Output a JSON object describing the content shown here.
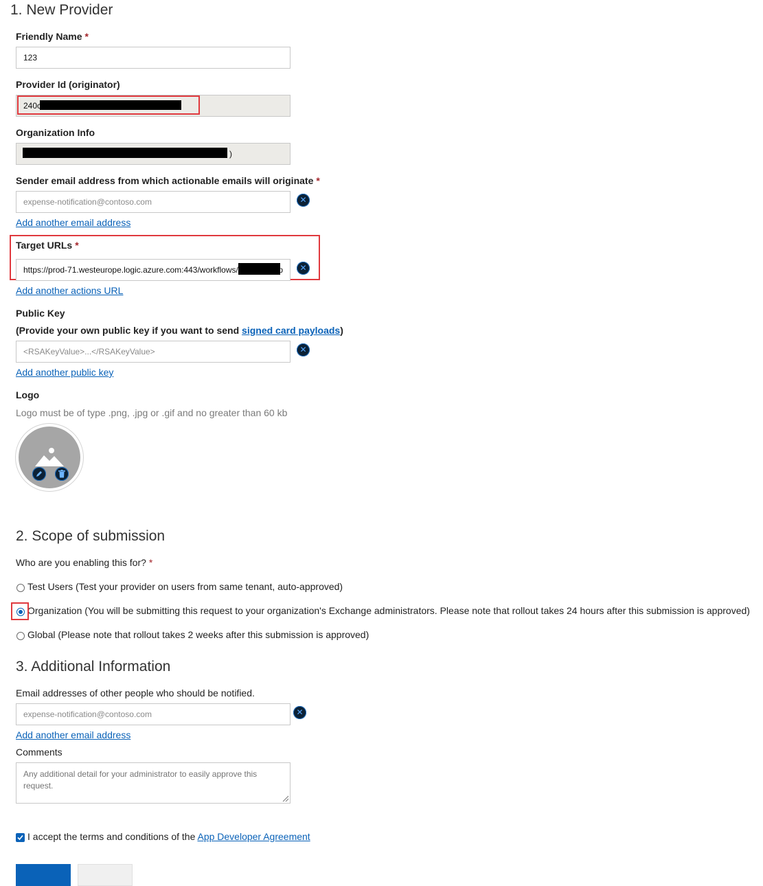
{
  "section1": {
    "title": "1. New Provider",
    "friendly_name": {
      "label": "Friendly Name",
      "required": "*",
      "value": "123"
    },
    "provider_id": {
      "label": "Provider Id (originator)",
      "value": "240c"
    },
    "org_info": {
      "label": "Organization Info",
      "value_suffix": ")"
    },
    "sender_email": {
      "label": "Sender email address from which actionable emails will originate",
      "required": "*",
      "placeholder": "expense-notification@contoso.com",
      "add_link": "Add another email address"
    },
    "target_urls": {
      "label": "Target URLs",
      "required": "*",
      "value": "https://prod-71.westeurope.logic.azure.com:443/workflows/",
      "value_tail": "p",
      "add_link": "Add another actions URL"
    },
    "public_key": {
      "label": "Public Key",
      "hint_prefix": "(Provide your own public key if you want to send ",
      "hint_link": "signed card payloads",
      "hint_suffix": ")",
      "placeholder": "<RSAKeyValue>...</RSAKeyValue>",
      "add_link": "Add another public key"
    },
    "logo": {
      "label": "Logo",
      "hint": "Logo must be of type .png, .jpg or .gif and no greater than 60 kb"
    }
  },
  "section2": {
    "title": "2. Scope of submission",
    "question": "Who are you enabling this for?",
    "required": "*",
    "options": [
      {
        "label": "Test Users (Test your provider on users from same tenant, auto-approved)",
        "selected": false
      },
      {
        "label": "Organization (You will be submitting this request to your organization's Exchange administrators. Please note that rollout takes 24 hours after this submission is approved)",
        "selected": true
      },
      {
        "label": "Global (Please note that rollout takes 2 weeks after this submission is approved)",
        "selected": false
      }
    ]
  },
  "section3": {
    "title": "3. Additional Information",
    "notify_label": "Email addresses of other people who should be notified.",
    "notify_placeholder": "expense-notification@contoso.com",
    "add_link": "Add another email address",
    "comments_label": "Comments",
    "comments_placeholder": "Any additional detail for your administrator to easily approve this request."
  },
  "terms": {
    "checked": true,
    "text": "I accept the terms and conditions of the ",
    "link": "App Developer Agreement"
  },
  "icons": {
    "remove": "close-circle-icon",
    "logo": "image-placeholder-icon",
    "edit": "pencil-icon",
    "delete": "trash-icon"
  },
  "colors": {
    "accent": "#0a62b8",
    "highlight": "#e0393e",
    "required": "#a4262c"
  }
}
